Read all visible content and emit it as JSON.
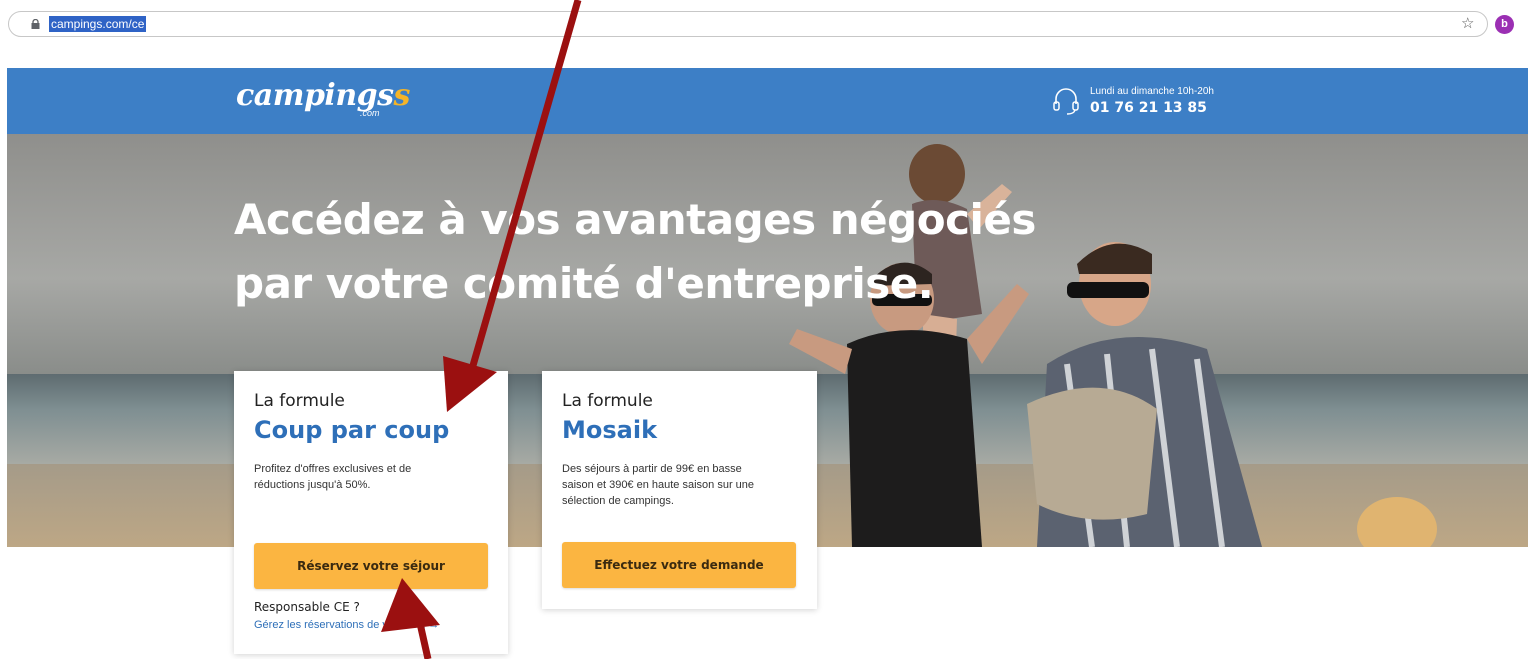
{
  "browser": {
    "url": "campings.com/ce",
    "star_icon": "☆",
    "profile_initial": "b"
  },
  "header": {
    "logo_main": "campings",
    "logo_s": "s",
    "logo_com": ".com",
    "phone_hours": "Lundi au dimanche 10h-20h",
    "phone_number": "01 76 21 13 85",
    "icons": [
      "lock-icon",
      "star-icon",
      "headset-icon"
    ]
  },
  "hero": {
    "title_line1": "Accédez à vos avantages négociés",
    "title_line2": "par votre comité d'entreprise."
  },
  "cards": [
    {
      "kicker": "La formule",
      "name": "Coup par coup",
      "description": "Profitez d'offres exclusives et de réductions jusqu'à 50%.",
      "button": "Réservez votre séjour",
      "resp_title": "Responsable CE ?",
      "resp_link": "Gérez les réservations de votre CE →"
    },
    {
      "kicker": "La formule",
      "name": "Mosaik",
      "description": "Des séjours à partir de 99€ en basse saison et 390€ en haute saison sur une sélection de campings.",
      "button": "Effectuez votre demande"
    }
  ],
  "colors": {
    "header_blue": "#3d7fc6",
    "accent_blue": "#2e6fb8",
    "button_yellow": "#fbb541",
    "annotation_red": "#9b1010"
  }
}
